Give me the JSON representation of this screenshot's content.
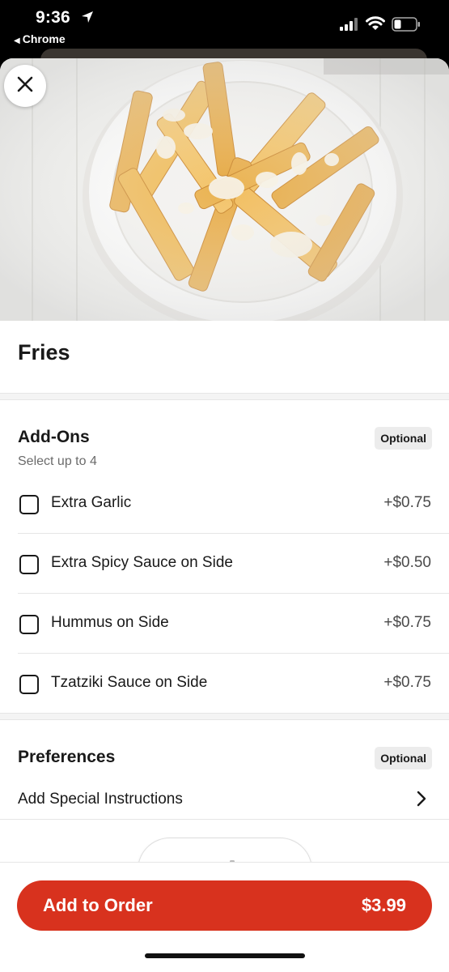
{
  "status_bar": {
    "time": "9:36",
    "back_app": "Chrome",
    "icons": [
      "location-arrow-icon",
      "cellular-signal-icon",
      "wifi-icon",
      "battery-icon"
    ]
  },
  "item": {
    "title": "Fries",
    "image": "fries-with-garlic-sauce-photo"
  },
  "addons": {
    "title": "Add-Ons",
    "badge": "Optional",
    "subtitle": "Select up to 4",
    "options": [
      {
        "label": "Extra Garlic",
        "price": "+$0.75",
        "checked": false
      },
      {
        "label": "Extra Spicy Sauce on Side",
        "price": "+$0.50",
        "checked": false
      },
      {
        "label": "Hummus on Side",
        "price": "+$0.75",
        "checked": false
      },
      {
        "label": "Tzatziki Sauce on Side",
        "price": "+$0.75",
        "checked": false
      }
    ]
  },
  "preferences": {
    "title": "Preferences",
    "badge": "Optional",
    "instructions_label": "Add Special Instructions"
  },
  "footer": {
    "button_label": "Add to Order",
    "button_price": "$3.99"
  },
  "colors": {
    "accent": "#d8321e",
    "text": "#191919",
    "badge_bg": "#ececec"
  }
}
